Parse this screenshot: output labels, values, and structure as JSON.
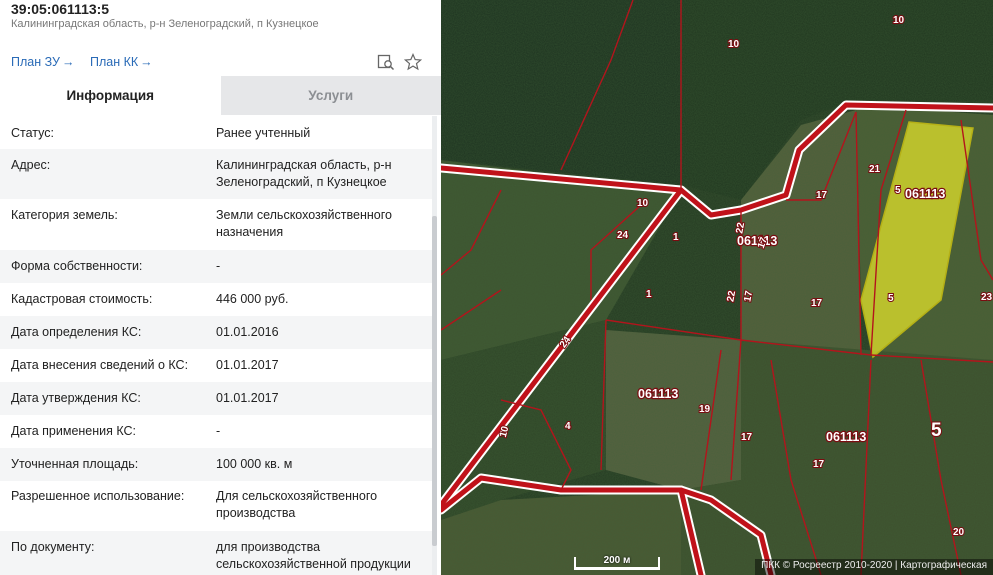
{
  "parcel": {
    "cad_number": "39:05:061113:5",
    "address_short": "Калининградская область, р-н Зеленоградский, п Кузнецкое"
  },
  "links": {
    "plan_zu": "План ЗУ",
    "plan_kk": "План КК",
    "arrow": "→"
  },
  "tabs": [
    {
      "label": "Информация",
      "active": true
    },
    {
      "label": "Услуги",
      "active": false
    }
  ],
  "info_rows": [
    {
      "label": "Статус:",
      "value": "Ранее учтенный"
    },
    {
      "label": "Адрес:",
      "value": "Калининградская область, р-н Зеленоградский, п Кузнецкое"
    },
    {
      "label": "Категория земель:",
      "value": "Земли сельскохозяйственного назначения"
    },
    {
      "label": "Форма собственности:",
      "value": "-"
    },
    {
      "label": "Кадастровая стоимость:",
      "value": "446 000 руб."
    },
    {
      "label": "Дата определения КС:",
      "value": "01.01.2016"
    },
    {
      "label": "Дата внесения сведений о КС:",
      "value": "01.01.2017"
    },
    {
      "label": "Дата утверждения КС:",
      "value": "01.01.2017"
    },
    {
      "label": "Дата применения КС:",
      "value": "-"
    },
    {
      "label": "Уточненная площадь:",
      "value": "100 000 кв. м"
    },
    {
      "label": "Разрешенное использование:",
      "value": "Для сельскохозяйственного производства"
    },
    {
      "label": "По документу:",
      "value": "для производства сельскохозяйственной продукции"
    }
  ],
  "map": {
    "quarter_labels": [
      "061113",
      "061113",
      "061113",
      "061113"
    ],
    "parcel_labels": [
      "10",
      "10",
      "10",
      "10",
      "21",
      "17",
      "17",
      "17",
      "17",
      "17",
      "24",
      "24",
      "1",
      "1",
      "22",
      "22",
      "17",
      "19",
      "4",
      "5",
      "5",
      "5",
      "23",
      "20"
    ],
    "scale_label": "200 м",
    "copyright": "ПКК © Росреестр 2010-2020 | Картографическая",
    "highlight_color": "#e6e62a",
    "boundary_color": "#c0121a"
  },
  "icons": {
    "search_map": "search-map-icon",
    "favorite": "star-icon"
  }
}
